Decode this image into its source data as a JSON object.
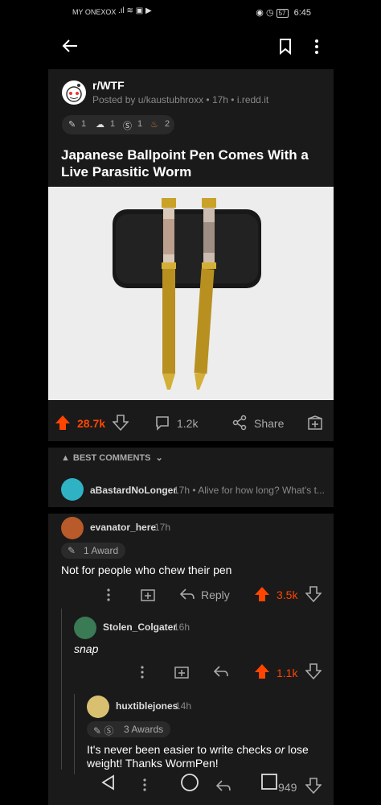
{
  "status": {
    "carrier": "MY ONEXOX",
    "time": "6:45",
    "battery": "57"
  },
  "post": {
    "subreddit": "r/WTF",
    "posted": "Posted by u/kaustubhroxx • 17h • i.redd.it",
    "awards": [
      {
        "icon": "award-1",
        "count": "1"
      },
      {
        "icon": "award-2",
        "count": "1"
      },
      {
        "icon": "award-3",
        "count": "1"
      },
      {
        "icon": "award-4",
        "count": "2"
      }
    ],
    "title": "Japanese Ballpoint Pen Comes With a Live Parasitic Worm",
    "upvotes": "28.7k",
    "comments": "1.2k",
    "share": "Share"
  },
  "sort_label": "BEST COMMENTS",
  "comments": [
    {
      "author": "aBastardNoLonger",
      "meta": "17h • Alive for how long? What's t..."
    },
    {
      "author": "evanator_here",
      "time": "17h",
      "awards": "1 Award",
      "body": "Not for people who chew their pen",
      "reply": "Reply",
      "score": "3.5k"
    },
    {
      "author": "Stolen_Colgater",
      "time": "16h",
      "body": "snap",
      "score": "1.1k"
    },
    {
      "author": "huxtiblejones",
      "time": "14h",
      "awards": "3 Awards",
      "body_a": "It's never been easier to write checks ",
      "body_em": "or",
      "body_b": " lose weight! Thanks WormPen!",
      "score": "949"
    }
  ],
  "colors": {
    "upvote": "#ff4500",
    "bg": "#1a1a1b"
  }
}
